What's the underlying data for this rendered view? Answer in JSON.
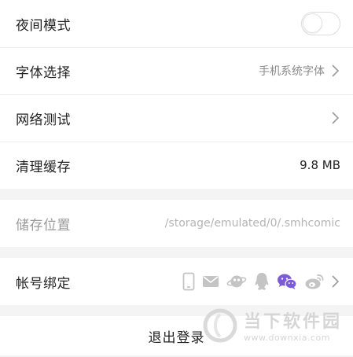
{
  "settings": {
    "night_mode": {
      "label": "夜间模式",
      "enabled": false
    },
    "font": {
      "label": "字体选择",
      "value": "手机系统字体"
    },
    "network": {
      "label": "网络测试"
    },
    "cache": {
      "label": "清理缓存",
      "value": "9.8 MB"
    }
  },
  "storage": {
    "label": "储存位置",
    "path": "/storage/emulated/0/.smhcomic"
  },
  "account": {
    "label": "帐号绑定",
    "icons": [
      "phone-icon",
      "mail-icon",
      "planet-icon",
      "qq-icon",
      "wechat-icon",
      "weibo-icon"
    ],
    "wechat_color": "#7b5cd6"
  },
  "logout": {
    "label": "退出登录"
  },
  "watermark": {
    "title": "当下软件园",
    "url": "www.downxia.com"
  }
}
